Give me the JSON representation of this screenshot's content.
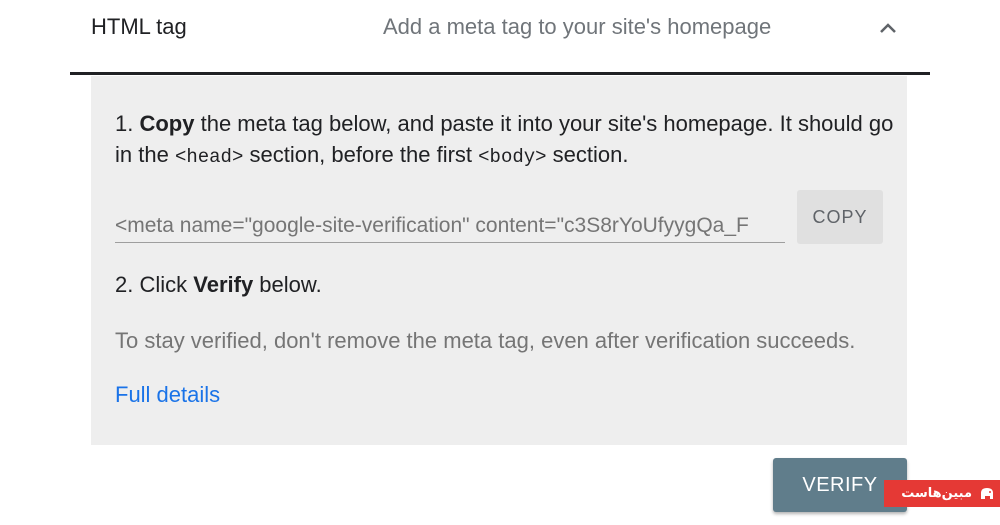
{
  "header": {
    "title": "HTML tag",
    "description": "Add a meta tag to your site's homepage",
    "collapse_icon": "chevron-up-icon"
  },
  "instructions": {
    "step1": {
      "number": "1.",
      "bold": "Copy",
      "text_a": " the meta tag below, and paste it into your site's homepage. It should go in the ",
      "code_head": "<head>",
      "text_b": " section, before the first ",
      "code_body": "<body>",
      "text_c": " section."
    },
    "meta_tag_value": "<meta name=\"google-site-verification\" content=\"c3S8rYoUfyygQa_F",
    "copy_label": "COPY",
    "step2": {
      "number": "2.",
      "text_a": " Click ",
      "bold": "Verify",
      "text_b": " below."
    },
    "note": "To stay verified, don't remove the meta tag, even after verification succeeds.",
    "full_details_link": "Full details"
  },
  "verify_label": "VERIFY",
  "watermark": {
    "text": "مبین‌هاست"
  },
  "colors": {
    "panel_bg": "#eeeeee",
    "link": "#1a73e8",
    "verify_bg": "#607d8b",
    "copy_bg": "#e0e0e0",
    "watermark_bg": "#e53935"
  }
}
